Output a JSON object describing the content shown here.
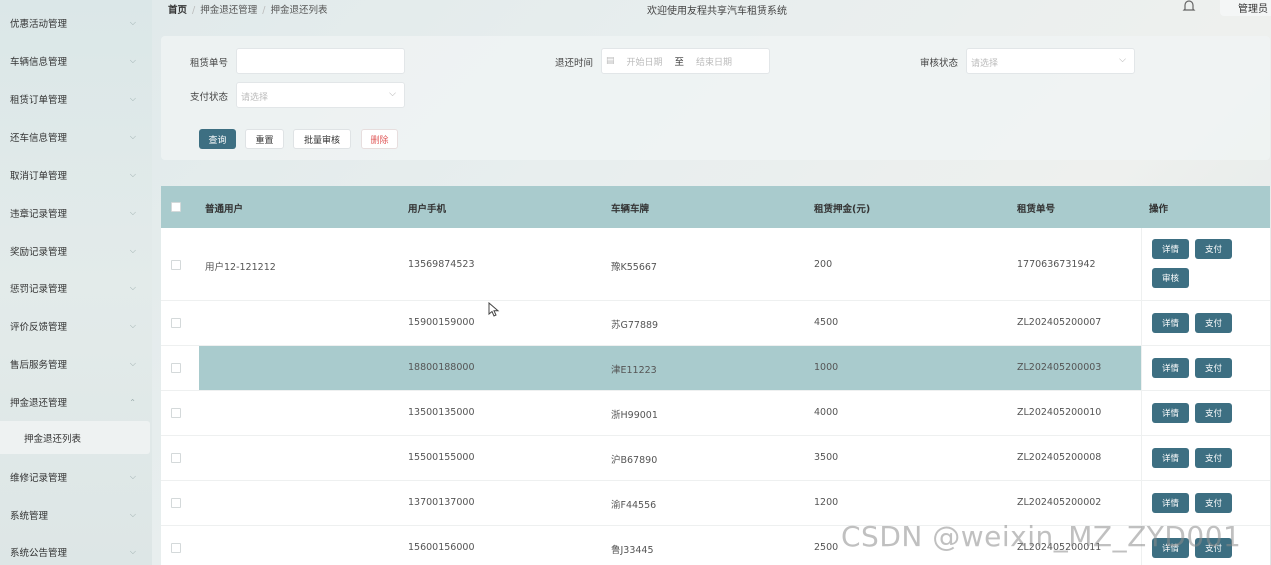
{
  "sidebar": {
    "items": [
      {
        "label": "优惠活动管理"
      },
      {
        "label": "车辆信息管理"
      },
      {
        "label": "租赁订单管理"
      },
      {
        "label": "还车信息管理"
      },
      {
        "label": "取消订单管理"
      },
      {
        "label": "违章记录管理"
      },
      {
        "label": "奖励记录管理"
      },
      {
        "label": "惩罚记录管理"
      },
      {
        "label": "评价反馈管理"
      },
      {
        "label": "售后服务管理"
      },
      {
        "label": "押金退还管理"
      },
      {
        "label": "维修记录管理"
      },
      {
        "label": "系统管理"
      },
      {
        "label": "系统公告管理"
      }
    ],
    "active_sub": "押金退还列表"
  },
  "header": {
    "breadcrumb": [
      "首页",
      "押金退还管理",
      "押金退还列表"
    ],
    "title": "欢迎使用友程共享汽车租赁系统",
    "user": "管理员"
  },
  "search": {
    "order_no_label": "租赁单号",
    "order_no_value": "",
    "return_time_label": "退还时间",
    "start_placeholder": "开始日期",
    "to_label": "至",
    "end_placeholder": "结束日期",
    "audit_label": "审核状态",
    "audit_placeholder": "请选择",
    "pay_label": "支付状态",
    "pay_placeholder": "请选择",
    "query_btn": "查询",
    "reset_btn": "重置",
    "batch_btn": "批量审核",
    "delete_btn": "删除"
  },
  "table": {
    "columns": [
      "普通用户",
      "用户手机",
      "车辆车牌",
      "租赁押金(元)",
      "租赁单号",
      "操作"
    ],
    "detail_btn": "详情",
    "pay_btn": "支付",
    "audit_btn": "审核",
    "rows": [
      {
        "user": "用户12-121212",
        "phone": "13569874523",
        "plate": "豫K55667",
        "deposit": "200",
        "order": "1770636731942"
      },
      {
        "user": "",
        "phone": "15900159000",
        "plate": "苏G77889",
        "deposit": "4500",
        "order": "ZL202405200007"
      },
      {
        "user": "",
        "phone": "18800188000",
        "plate": "津E11223",
        "deposit": "1000",
        "order": "ZL202405200003"
      },
      {
        "user": "",
        "phone": "13500135000",
        "plate": "浙H99001",
        "deposit": "4000",
        "order": "ZL202405200010"
      },
      {
        "user": "",
        "phone": "15500155000",
        "plate": "沪B67890",
        "deposit": "3500",
        "order": "ZL202405200008"
      },
      {
        "user": "",
        "phone": "13700137000",
        "plate": "渝F44556",
        "deposit": "1200",
        "order": "ZL202405200002"
      },
      {
        "user": "",
        "phone": "15600156000",
        "plate": "鲁J33445",
        "deposit": "2500",
        "order": "ZL202405200011"
      }
    ]
  },
  "watermark": "CSDN @weixin_MZ_ZYD001"
}
